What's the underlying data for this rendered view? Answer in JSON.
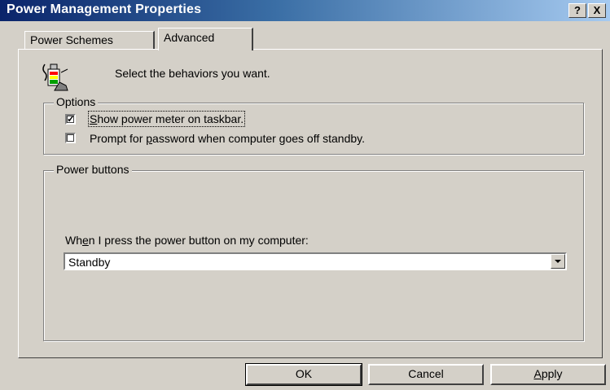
{
  "window": {
    "title": "Power Management Properties",
    "help_button": "?",
    "close_button": "X"
  },
  "tabs": [
    {
      "label": "Power Schemes",
      "active": false
    },
    {
      "label": "Advanced",
      "active": true
    }
  ],
  "header": {
    "text": "Select the behaviors you want.",
    "icon": "power-meter-icon"
  },
  "options": {
    "legend": "Options",
    "items": [
      {
        "pre": "",
        "accel": "S",
        "post": "how power meter on taskbar.",
        "checked": true
      },
      {
        "pre": "Prompt for ",
        "accel": "p",
        "post": "assword when computer goes off standby.",
        "checked": false
      }
    ]
  },
  "power_buttons": {
    "legend": "Power buttons",
    "label_pre": "Wh",
    "label_accel": "e",
    "label_post": "n I press the power button on my computer:",
    "selected": "Standby"
  },
  "buttons": {
    "ok": "OK",
    "cancel": "Cancel",
    "apply_accel": "A",
    "apply_rest": "pply"
  },
  "colors": {
    "face": "#d4d0c8",
    "title_start": "#0a246a",
    "title_end": "#a6caf0"
  }
}
